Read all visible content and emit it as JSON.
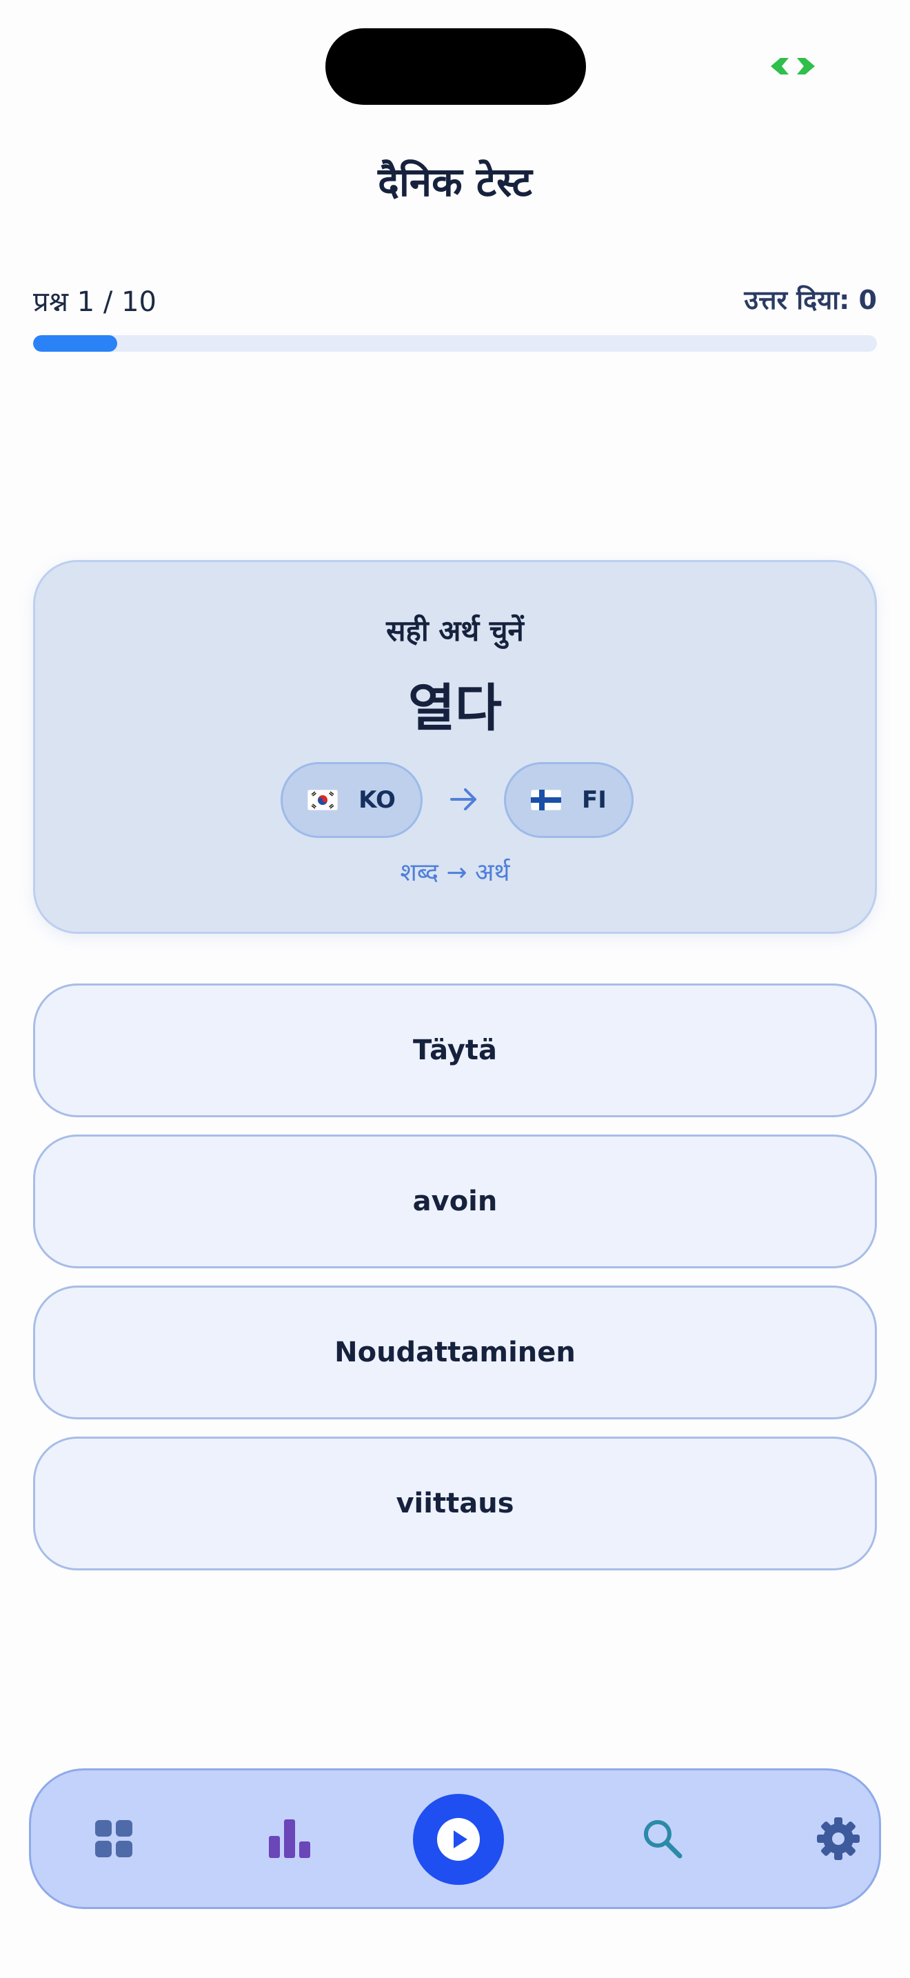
{
  "header": {
    "title": "दैनिक टेस्ट"
  },
  "progress": {
    "question_label": "प्रश्न 1 / 10",
    "answered_label": "उत्तर दिया: 0",
    "current": 1,
    "total": 10,
    "fraction": 0.1
  },
  "question": {
    "prompt": "सही अर्थ चुनें",
    "word": "열다",
    "source_lang": {
      "code": "KO",
      "flag_icon": "south-korea-flag-icon"
    },
    "target_lang": {
      "code": "FI",
      "flag_icon": "finland-flag-icon"
    },
    "direction": "शब्द → अर्थ"
  },
  "options": [
    {
      "label": "Täytä"
    },
    {
      "label": "avoin"
    },
    {
      "label": "Noudattaminen"
    },
    {
      "label": "viittaus"
    }
  ],
  "nav": {
    "items": [
      {
        "icon": "grid-icon",
        "color": "#4f6aa8"
      },
      {
        "icon": "bar-chart-icon",
        "color": "#6b46b8"
      },
      {
        "icon": "play-icon",
        "color": "#1f4ff0"
      },
      {
        "icon": "search-icon",
        "color": "#2a8aa8"
      },
      {
        "icon": "gear-icon",
        "color": "#3c5a9c"
      }
    ]
  },
  "colors": {
    "accent": "#2a82f7",
    "status_icon": "#2fbf4a"
  }
}
